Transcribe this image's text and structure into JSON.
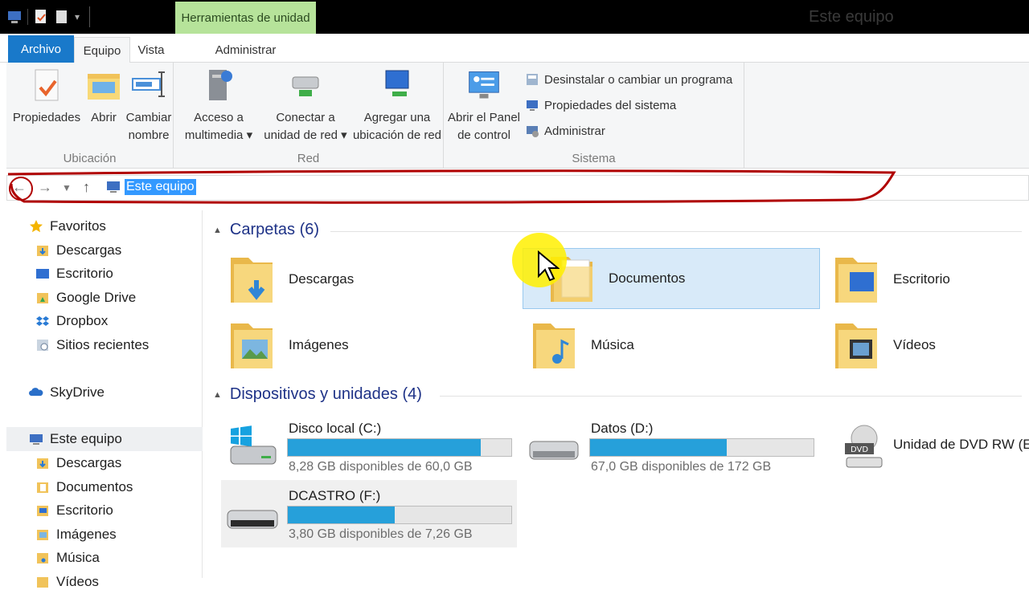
{
  "window": {
    "title": "Este equipo",
    "tools_tab": "Herramientas de unidad"
  },
  "tabs": [
    {
      "label": "Archivo"
    },
    {
      "label": "Equipo"
    },
    {
      "label": "Vista"
    },
    {
      "label": "Administrar"
    }
  ],
  "ribbon": {
    "groups": [
      {
        "label": "Ubicación"
      },
      {
        "label": "Red"
      },
      {
        "label": "Sistema"
      }
    ],
    "buttons": [
      {
        "line1": "Propiedades",
        "line2": ""
      },
      {
        "line1": "Abrir",
        "line2": ""
      },
      {
        "line1": "Cambiar",
        "line2": "nombre"
      },
      {
        "line1": "Acceso a",
        "line2": "multimedia ▾"
      },
      {
        "line1": "Conectar a",
        "line2": "unidad de red ▾"
      },
      {
        "line1": "Agregar una",
        "line2": "ubicación de red"
      },
      {
        "line1": "Abrir el Panel",
        "line2": "de control"
      }
    ],
    "system_items": [
      {
        "label": "Desinstalar o cambiar un programa"
      },
      {
        "label": "Propiedades del sistema"
      },
      {
        "label": "Administrar"
      }
    ]
  },
  "address": {
    "value": "Este equipo"
  },
  "nav": [
    {
      "label": "Favoritos"
    },
    {
      "label": "Descargas"
    },
    {
      "label": "Escritorio"
    },
    {
      "label": "Google Drive"
    },
    {
      "label": "Dropbox"
    },
    {
      "label": "Sitios recientes"
    },
    {
      "label": "SkyDrive"
    },
    {
      "label": "Este equipo"
    },
    {
      "label": "Descargas"
    },
    {
      "label": "Documentos"
    },
    {
      "label": "Escritorio"
    },
    {
      "label": "Imágenes"
    },
    {
      "label": "Música"
    },
    {
      "label": "Vídeos"
    }
  ],
  "sections": {
    "folders_title": "Carpetas (6)",
    "devices_title": "Dispositivos y unidades (4)"
  },
  "folders": [
    {
      "name": "Descargas"
    },
    {
      "name": "Documentos"
    },
    {
      "name": "Escritorio"
    },
    {
      "name": "Imágenes"
    },
    {
      "name": "Música"
    },
    {
      "name": "Vídeos"
    }
  ],
  "drives": [
    {
      "name": "Disco local (C:)",
      "free": "8,28 GB disponibles de 60,0 GB",
      "used_fraction": 0.862
    },
    {
      "name": "Datos (D:)",
      "free": "67,0 GB disponibles de 172 GB",
      "used_fraction": 0.61
    },
    {
      "name": "Unidad de DVD RW (E:)",
      "dvd_label": "DVD"
    },
    {
      "name": "DCASTRO (F:)",
      "free": "3,80 GB disponibles de 7,26 GB",
      "used_fraction": 0.477
    }
  ],
  "colors": {
    "accent": "#1979ca",
    "drive_fill": "#26a0da",
    "annotation": "#b00000"
  }
}
